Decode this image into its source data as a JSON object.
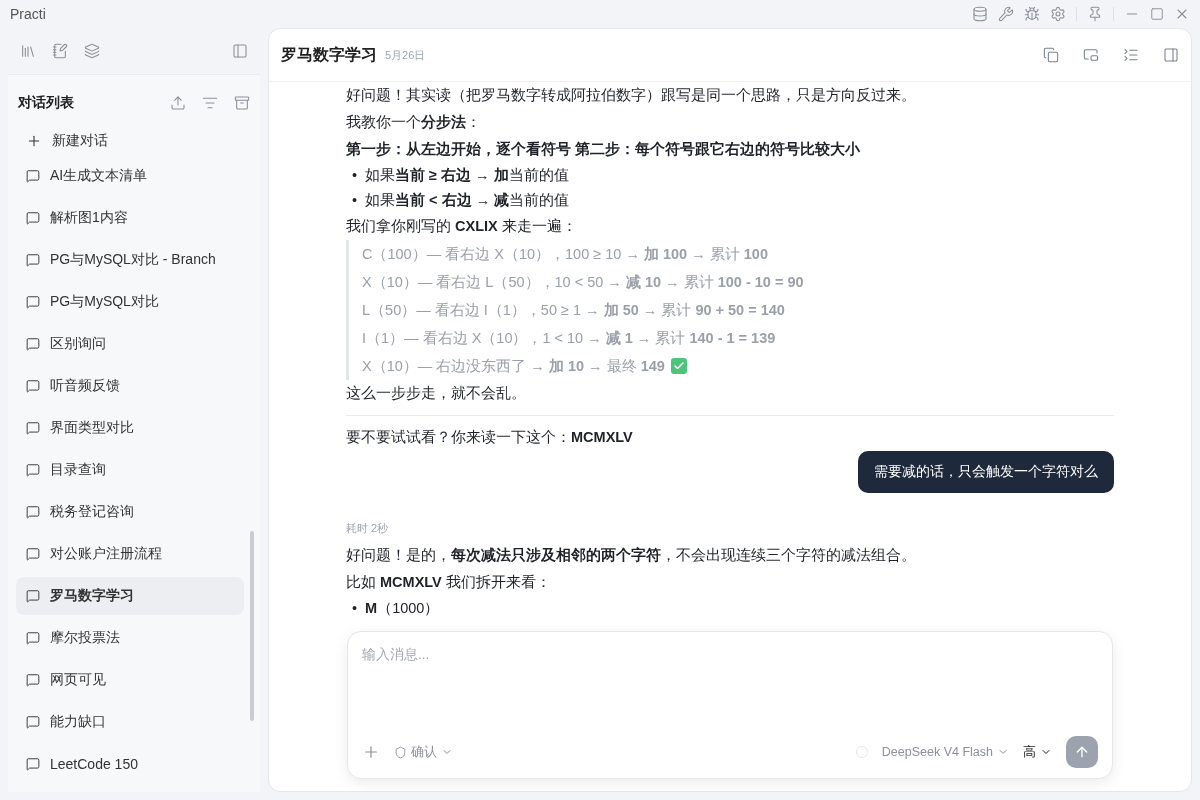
{
  "app": {
    "title": "Practi"
  },
  "sidebar": {
    "section_title": "对话列表",
    "new_chat": "新建对话",
    "items": [
      {
        "label": "AI生成文本清单",
        "selected": false
      },
      {
        "label": "解析图1内容",
        "selected": false
      },
      {
        "label": "PG与MySQL对比 - Branch",
        "selected": false
      },
      {
        "label": "PG与MySQL对比",
        "selected": false
      },
      {
        "label": "区别询问",
        "selected": false
      },
      {
        "label": "听音频反馈",
        "selected": false
      },
      {
        "label": "界面类型对比",
        "selected": false
      },
      {
        "label": "目录查询",
        "selected": false
      },
      {
        "label": "税务登记咨询",
        "selected": false
      },
      {
        "label": "对公账户注册流程",
        "selected": false
      },
      {
        "label": "罗马数字学习",
        "selected": true
      },
      {
        "label": "摩尔投票法",
        "selected": false
      },
      {
        "label": "网页可见",
        "selected": false
      },
      {
        "label": "能力缺口",
        "selected": false
      },
      {
        "label": "LeetCode 150",
        "selected": false
      }
    ]
  },
  "chat": {
    "title": "罗马数字学习",
    "date": "5月26日",
    "messages": [
      {
        "kind": "assistant",
        "blocks": [
          {
            "kind": "para",
            "text": "好问题！其实读（把罗马数字转成阿拉伯数字）跟写是同一个思路，只是方向反过来。"
          },
          {
            "kind": "para",
            "text": "我教你一个**分步法**："
          },
          {
            "kind": "para",
            "text": "**第一步：从左边开始，逐个看符号 第二步：每个符号跟它右边的符号比较大小**"
          },
          {
            "kind": "bullets",
            "marker": "•",
            "items": [
              "如果**当前 ≥ 右边** → **加**当前的值",
              "如果**当前 < 右边** → **减**当前的值"
            ]
          },
          {
            "kind": "para",
            "text": "我们拿你刚写的 **CXLIX** 来走一遍："
          },
          {
            "kind": "quote",
            "lines": [
              {
                "text": "C（100）— 看右边 X（10），100 ≥ 10 → **加 100** → 累计 **100**",
                "done": false
              },
              {
                "text": "X（10）— 看右边 L（50），10 < 50 → **减 10** → 累计 **100 - 10 = 90**",
                "done": false
              },
              {
                "text": "L（50）— 看右边 I（1），50 ≥ 1 → **加 50** → 累计 **90 + 50 = 140**",
                "done": false
              },
              {
                "text": "I（1）— 看右边 X（10），1 < 10 → **减 1** → 累计 **140 - 1 = 139**",
                "done": false
              },
              {
                "text": "X（10）— 右边没东西了 → **加 10** → 最终 **149**",
                "done": true
              }
            ]
          },
          {
            "kind": "para",
            "text": "这么一步步走，就不会乱。"
          },
          {
            "kind": "rule"
          },
          {
            "kind": "para",
            "text": "要不要试试看？你来读一下这个：**MCMXLV**"
          }
        ]
      },
      {
        "kind": "user",
        "text": "需要减的话，只会触发一个字符对么"
      },
      {
        "kind": "assistant",
        "meta": "耗时 2秒",
        "blocks": [
          {
            "kind": "para",
            "text": "好问题！是的，**每次减法只涉及相邻的两个字符**，不会出现连续三个字符的减法组合。"
          },
          {
            "kind": "para",
            "text": "比如 **MCMXLV** 我们拆开来看："
          },
          {
            "kind": "bullets",
            "marker": "•",
            "items": [
              "**M**（1000）"
            ]
          }
        ]
      }
    ]
  },
  "composer": {
    "placeholder": "输入消息...",
    "mode": "确认",
    "model": "DeepSeek V4 Flash",
    "effort": "高",
    "send_disabled": true
  }
}
